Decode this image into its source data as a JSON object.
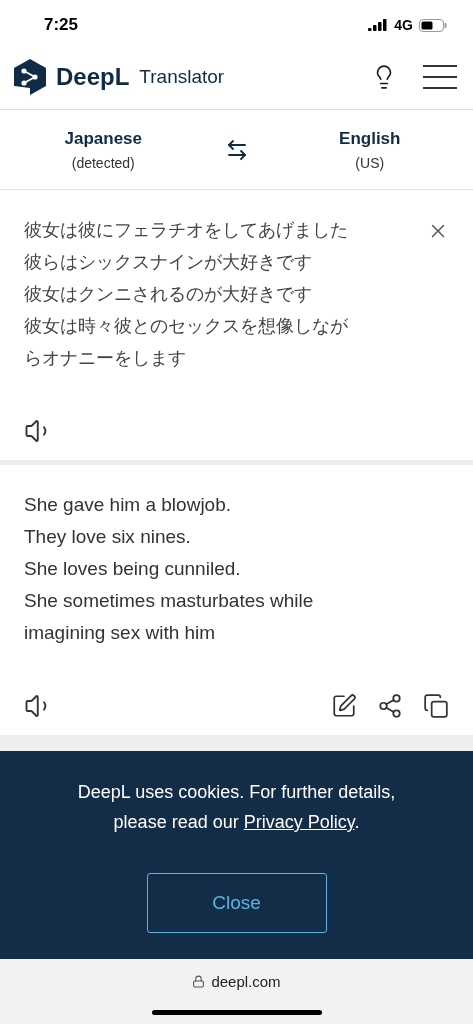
{
  "status_bar": {
    "time": "7:25",
    "network": "4G"
  },
  "header": {
    "brand": "DeepL",
    "product": "Translator"
  },
  "languages": {
    "source": {
      "name": "Japanese",
      "note": "(detected)"
    },
    "target": {
      "name": "English",
      "note": "(US)"
    }
  },
  "source_text": [
    "彼女は彼にフェラチオをしてあげました",
    "彼らはシックスナインが大好きです",
    "彼女はクンニされるのが大好きです",
    "彼女は時々彼とのセックスを想像しなが",
    "らオナニーをします"
  ],
  "target_text": [
    "She gave him a blowjob.",
    "They love six nines.",
    "She loves being cunniled.",
    "She sometimes masturbates while",
    "imagining sex with him"
  ],
  "cookie_banner": {
    "text_before": "DeepL uses cookies. For further details, please read our ",
    "link": "Privacy Policy",
    "text_after": ".",
    "button": "Close"
  },
  "address_bar": {
    "url": "deepl.com"
  }
}
